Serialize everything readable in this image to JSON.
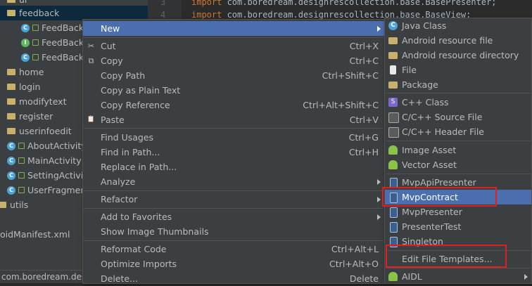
{
  "project_tree": {
    "items": [
      {
        "label": "ui",
        "kind": "folder"
      },
      {
        "label": "feedback",
        "kind": "folder"
      },
      {
        "label": "FeedBack",
        "kind": "class"
      },
      {
        "label": "FeedBack",
        "kind": "interface"
      },
      {
        "label": "FeedBack",
        "kind": "class"
      },
      {
        "label": "home",
        "kind": "folder"
      },
      {
        "label": "login",
        "kind": "folder"
      },
      {
        "label": "modifytext",
        "kind": "folder"
      },
      {
        "label": "register",
        "kind": "folder"
      },
      {
        "label": "userinfoedit",
        "kind": "folder"
      },
      {
        "label": "AboutActivity",
        "kind": "class"
      },
      {
        "label": "MainActivity",
        "kind": "class"
      },
      {
        "label": "SettingActivit",
        "kind": "class"
      },
      {
        "label": "UserFragmen",
        "kind": "class"
      },
      {
        "label": "utils",
        "kind": "folder"
      },
      {
        "label": "oidManifest.xml",
        "kind": "file"
      }
    ],
    "bottom_text": "com.boredream.desig"
  },
  "editor": {
    "line_numbers": [
      "3",
      "4"
    ],
    "lines": [
      {
        "kw": "import",
        "rest": " com.boredream.designrescollection.base.BasePresenter;"
      },
      {
        "kw": "import",
        "rest": " com.boredream.designrescollection.base.BaseView;"
      }
    ]
  },
  "context_menu": {
    "items": [
      {
        "label": "New",
        "shortcut": "",
        "icon": "",
        "submenu": true,
        "highlighted": true
      },
      {
        "label": "Cut",
        "shortcut": "Ctrl+X",
        "icon": "✂"
      },
      {
        "label": "Copy",
        "shortcut": "Ctrl+C",
        "icon": "⧉"
      },
      {
        "label": "Copy Path",
        "shortcut": "Ctrl+Shift+C",
        "icon": ""
      },
      {
        "label": "Copy as Plain Text",
        "shortcut": "",
        "icon": ""
      },
      {
        "label": "Copy Reference",
        "shortcut": "Ctrl+Alt+Shift+C",
        "icon": ""
      },
      {
        "label": "Paste",
        "shortcut": "Ctrl+V",
        "icon": "📋"
      },
      {
        "label": "Find Usages",
        "shortcut": "Ctrl+G",
        "icon": ""
      },
      {
        "label": "Find in Path...",
        "shortcut": "Ctrl+H",
        "icon": ""
      },
      {
        "label": "Replace in Path...",
        "shortcut": "",
        "icon": ""
      },
      {
        "label": "Analyze",
        "shortcut": "",
        "icon": "",
        "submenu": true
      },
      {
        "label": "Refactor",
        "shortcut": "",
        "icon": "",
        "submenu": true
      },
      {
        "label": "Add to Favorites",
        "shortcut": "",
        "icon": "",
        "submenu": true
      },
      {
        "label": "Show Image Thumbnails",
        "shortcut": "",
        "icon": ""
      },
      {
        "label": "Reformat Code",
        "shortcut": "Ctrl+Alt+L",
        "icon": ""
      },
      {
        "label": "Optimize Imports",
        "shortcut": "Ctrl+Alt+O",
        "icon": ""
      },
      {
        "label": "Delete...",
        "shortcut": "Delete",
        "icon": ""
      }
    ]
  },
  "new_submenu": {
    "items": [
      {
        "label": "Java Class",
        "icon": "C",
        "kind": "c"
      },
      {
        "label": "Android resource file",
        "icon": "",
        "kind": "folder"
      },
      {
        "label": "Android resource directory",
        "icon": "",
        "kind": "folder"
      },
      {
        "label": "File",
        "icon": "",
        "kind": "file"
      },
      {
        "label": "Package",
        "icon": "",
        "kind": "folder"
      },
      {
        "label": "C++ Class",
        "icon": "S",
        "kind": "cpp"
      },
      {
        "label": "C/C++ Source File",
        "icon": "",
        "kind": "h"
      },
      {
        "label": "C/C++ Header File",
        "icon": "",
        "kind": "h"
      },
      {
        "label": "Image Asset",
        "icon": "",
        "kind": "droid"
      },
      {
        "label": "Vector Asset",
        "icon": "",
        "kind": "droid"
      },
      {
        "label": "MvpApiPresenter",
        "icon": "",
        "kind": "tpl"
      },
      {
        "label": "MvpContract",
        "icon": "",
        "kind": "tpl",
        "highlighted": true
      },
      {
        "label": "MvpPresenter",
        "icon": "",
        "kind": "tpl"
      },
      {
        "label": "PresenterTest",
        "icon": "",
        "kind": "tpl"
      },
      {
        "label": "Singleton",
        "icon": "",
        "kind": "tpl"
      },
      {
        "label": "Edit File Templates...",
        "icon": "",
        "kind": "none"
      },
      {
        "label": "AIDL",
        "icon": "",
        "kind": "droid",
        "submenu": true
      }
    ]
  },
  "colors": {
    "highlight": "#4b6eaf",
    "annotation": "#e02020"
  }
}
